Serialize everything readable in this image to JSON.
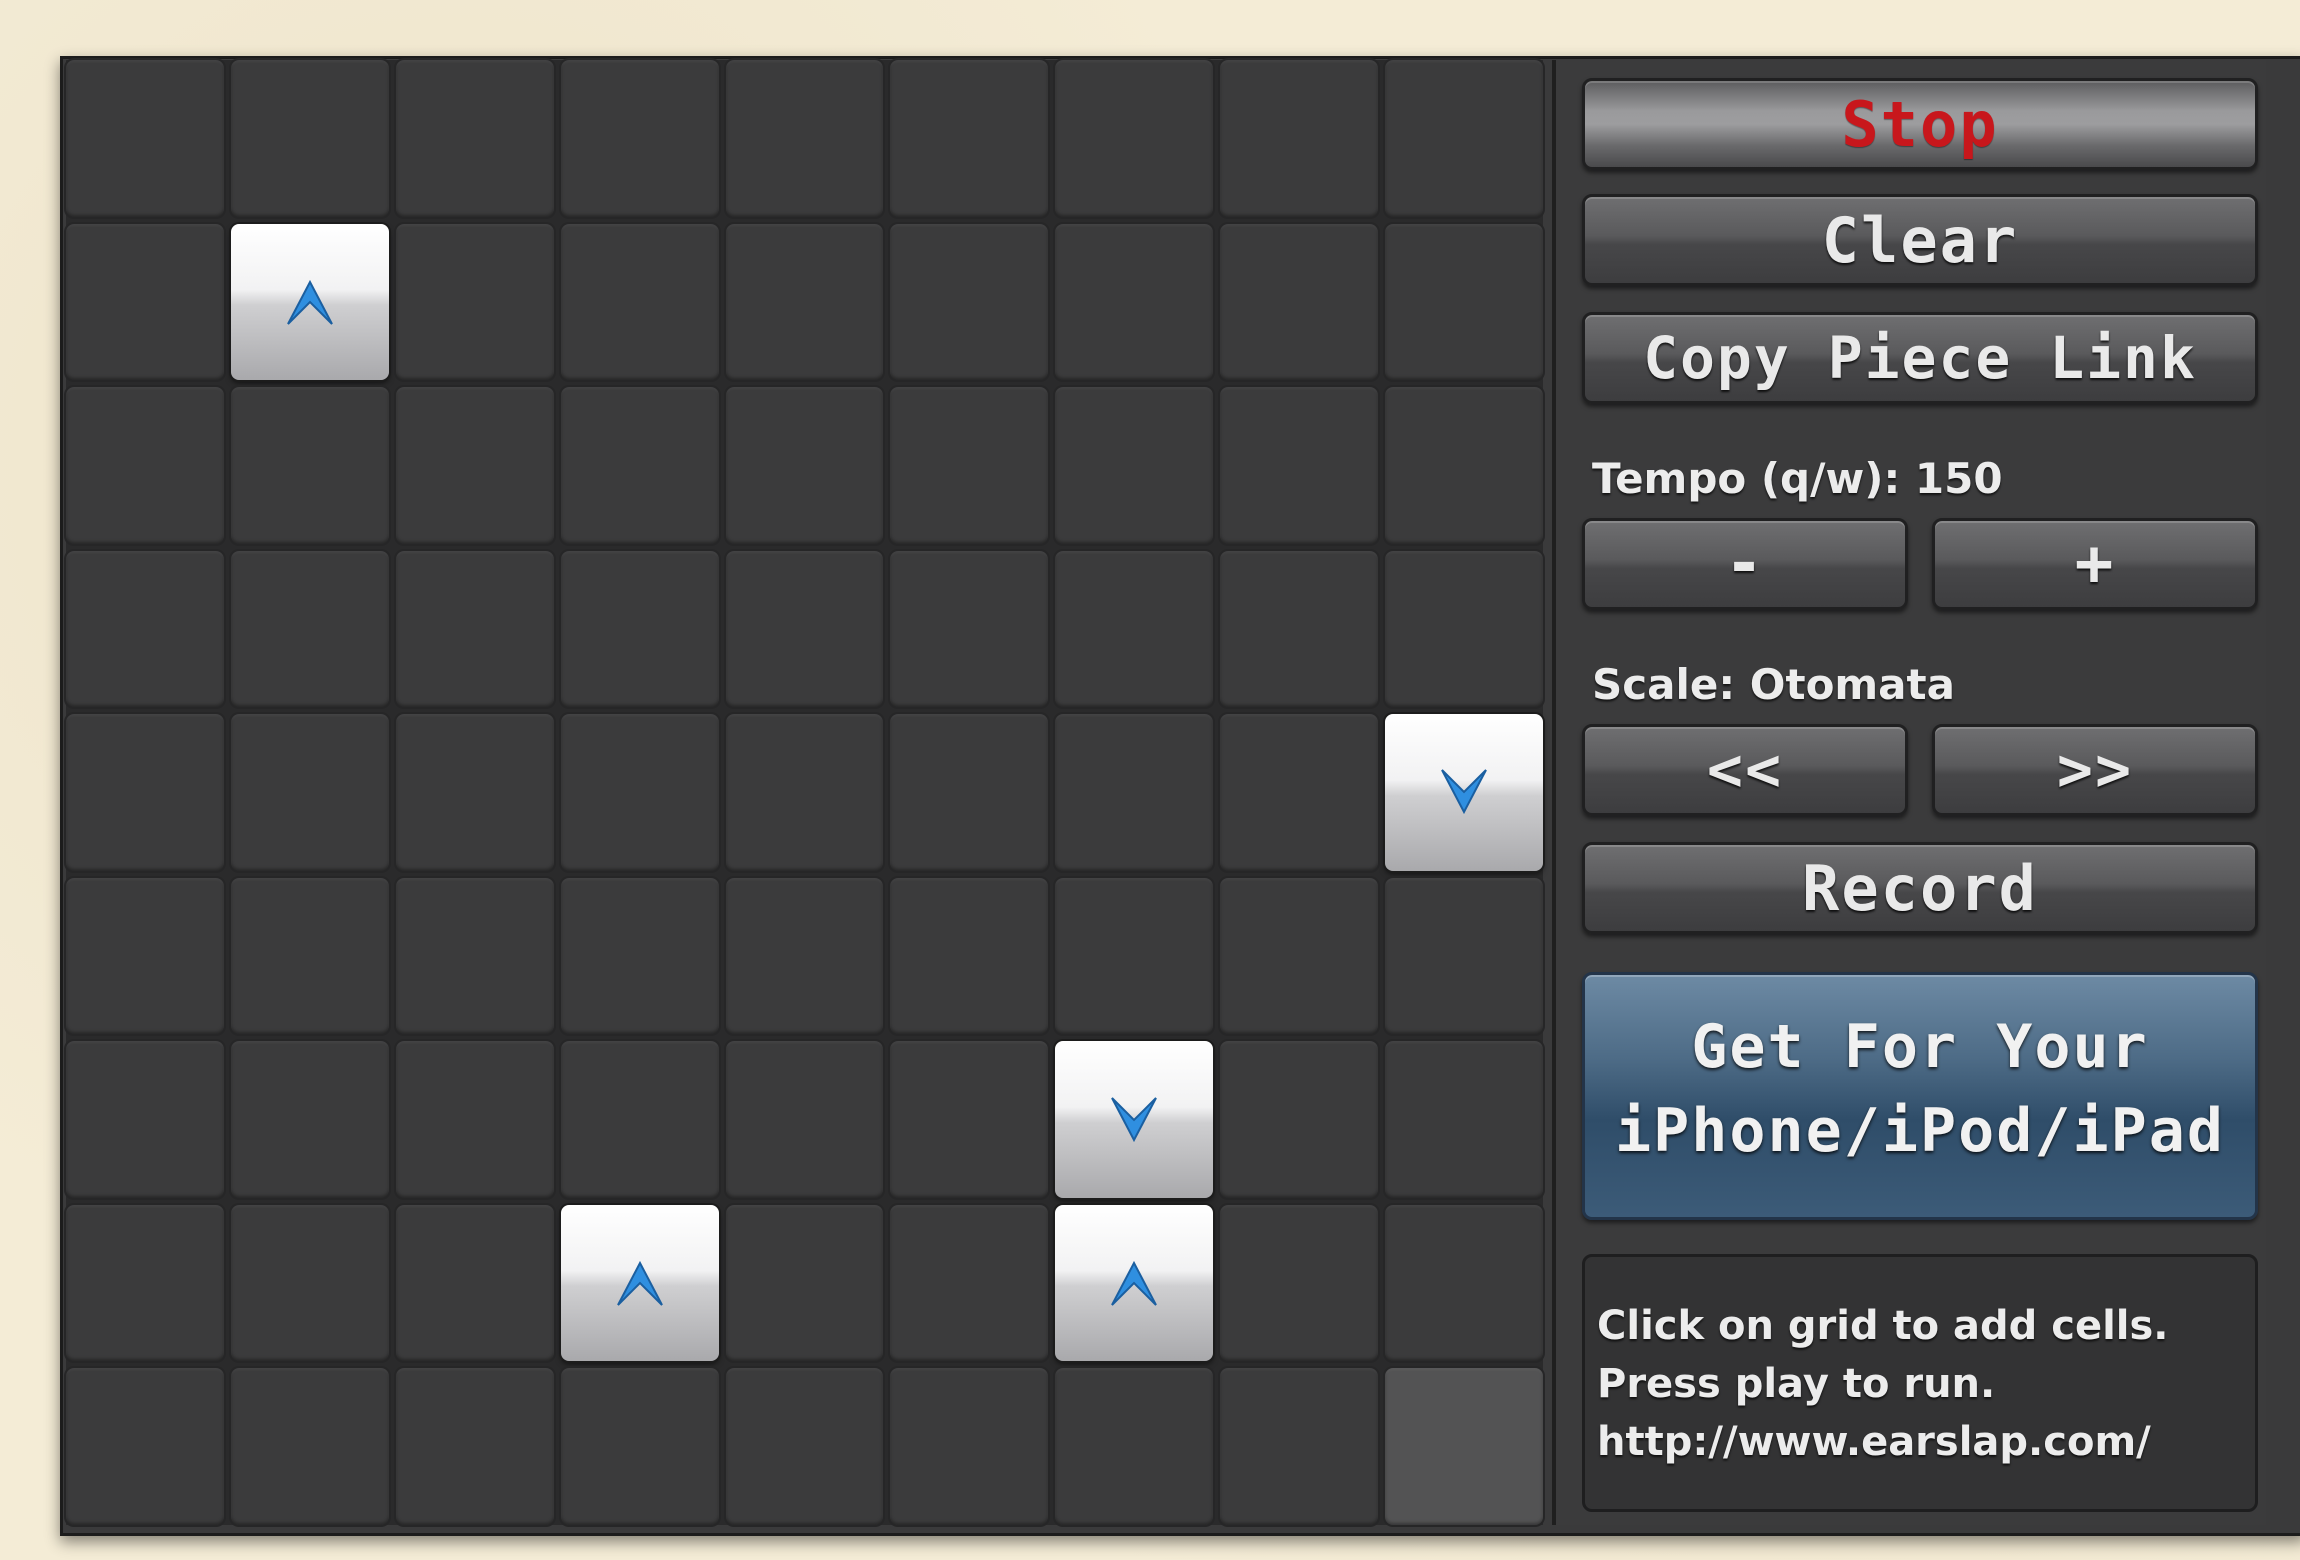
{
  "grid": {
    "rows": 9,
    "cols": 9,
    "active_cells": [
      {
        "row": 1,
        "col": 1,
        "direction": "up"
      },
      {
        "row": 4,
        "col": 8,
        "direction": "down"
      },
      {
        "row": 6,
        "col": 6,
        "direction": "down"
      },
      {
        "row": 7,
        "col": 3,
        "direction": "up"
      },
      {
        "row": 7,
        "col": 6,
        "direction": "up"
      }
    ],
    "highlight_cell": {
      "row": 8,
      "col": 8
    },
    "arrow_color": "#2f8fe0"
  },
  "controls": {
    "stop_label": "Stop",
    "clear_label": "Clear",
    "copy_link_label": "Copy Piece Link",
    "tempo_label": "Tempo (q/w): 150",
    "tempo_minus_label": "-",
    "tempo_plus_label": "+",
    "scale_label": "Scale: Otomata",
    "scale_prev_label": "<<",
    "scale_next_label": ">>",
    "record_label": "Record",
    "promo_line1": "Get For Your",
    "promo_line2": "iPhone/iPod/iPad"
  },
  "info": {
    "line1": "Click on grid to add cells.",
    "line2": "Press play to run.",
    "line3": "http://www.earslap.com/"
  },
  "colors": {
    "stop_text": "#c8171c",
    "promo_blue": "#4d6b86"
  }
}
